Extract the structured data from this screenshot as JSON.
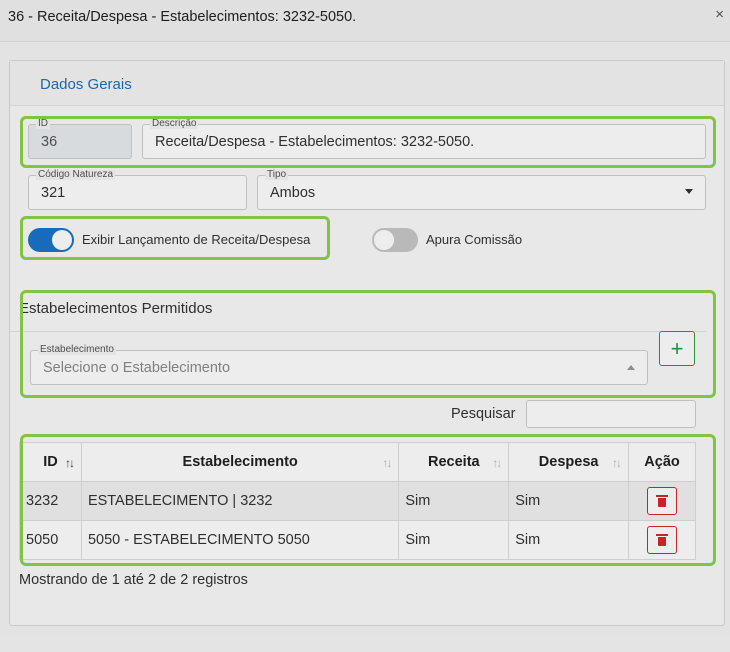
{
  "window": {
    "title": "36 - Receita/Despesa - Estabelecimentos: 3232-5050.",
    "close_glyph": "×"
  },
  "tabs": {
    "dados_gerais": "Dados Gerais"
  },
  "form": {
    "id": {
      "label": "ID",
      "value": "36"
    },
    "descricao": {
      "label": "Descrição",
      "value": "Receita/Despesa - Estabelecimentos:  3232-5050."
    },
    "codigo_natureza": {
      "label": "Código Natureza",
      "value": "321"
    },
    "tipo": {
      "label": "Tipo",
      "value": "Ambos"
    },
    "toggle_exibir": {
      "label": "Exibir Lançamento de Receita/Despesa",
      "checked": true
    },
    "toggle_comissao": {
      "label": "Apura Comissão",
      "checked": false
    }
  },
  "estabelecimentos": {
    "section_title": "Estabelecimentos Permitidos",
    "select_label": "Estabelecimento",
    "select_placeholder": "Selecione o Estabelecimento",
    "add_glyph": "+",
    "search_label": "Pesquisar",
    "search_value": "",
    "columns": [
      "ID",
      "Estabelecimento",
      "Receita",
      "Despesa",
      "Ação"
    ],
    "rows": [
      {
        "id": "3232",
        "estabelecimento": "ESTABELECIMENTO | 3232",
        "receita": "Sim",
        "despesa": "Sim"
      },
      {
        "id": "5050",
        "estabelecimento": "5050 - ESTABELECIMENTO 5050",
        "receita": "Sim",
        "despesa": "Sim"
      }
    ],
    "info": "Mostrando de 1 até 2 de 2 registros"
  },
  "colors": {
    "highlight": "#8bd34a",
    "toggle_on": "#1a73c9",
    "add": "#2a9a3a",
    "delete": "#d62828",
    "tab": "#1d6fb8"
  },
  "icons": {
    "close": "close-icon",
    "add": "plus-icon",
    "delete": "trash-icon",
    "sort": "sort-icon",
    "caret": "chevron-down-icon"
  }
}
